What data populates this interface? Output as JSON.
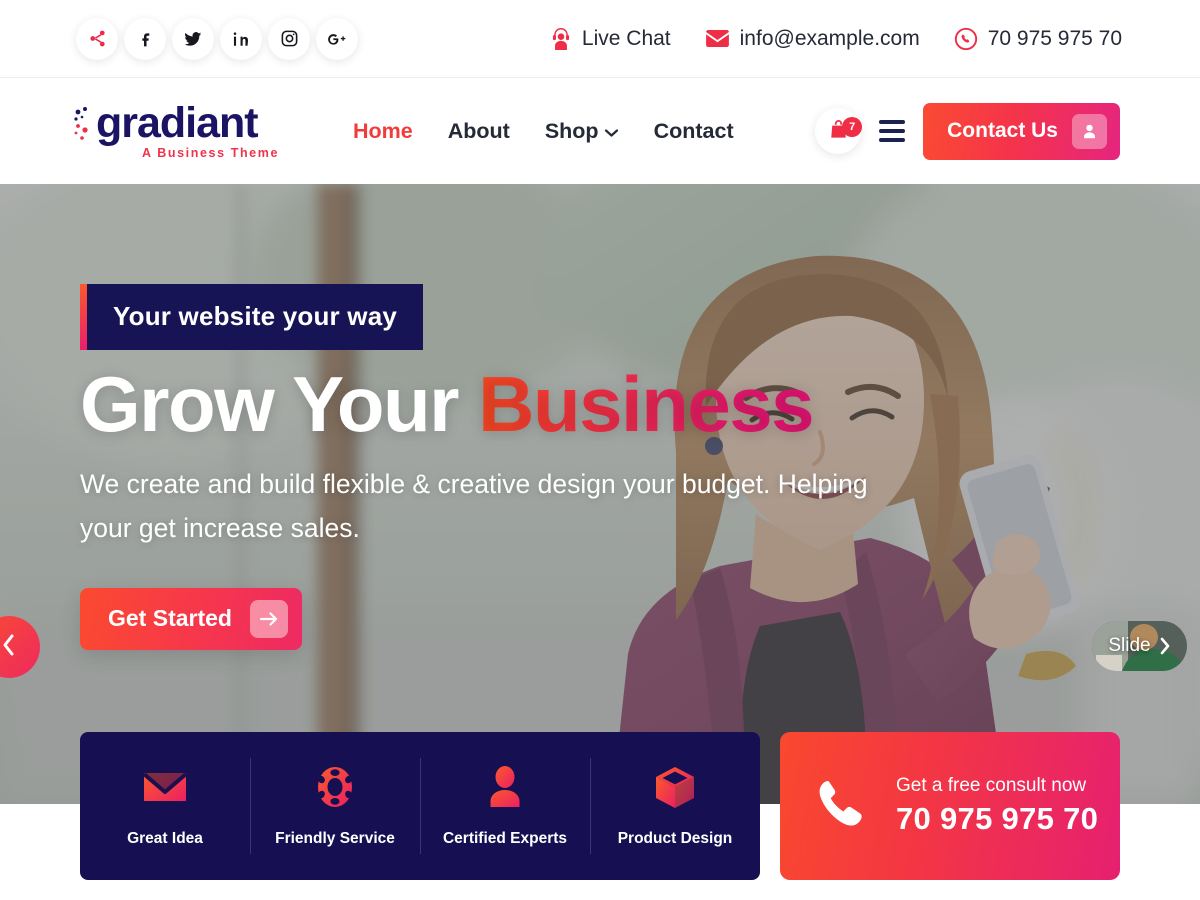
{
  "topbar": {
    "social": [
      {
        "name": "share-icon",
        "label": "Share"
      },
      {
        "name": "facebook-icon",
        "label": "Facebook"
      },
      {
        "name": "twitter-icon",
        "label": "Twitter"
      },
      {
        "name": "linkedin-icon",
        "label": "LinkedIn"
      },
      {
        "name": "instagram-icon",
        "label": "Instagram"
      },
      {
        "name": "googleplus-icon",
        "label": "Google Plus"
      }
    ],
    "live_chat": "Live Chat",
    "email": "info@example.com",
    "phone": "70 975 975 70"
  },
  "header": {
    "logo_name": "gradiant",
    "logo_tagline": "A Business Theme",
    "nav": [
      {
        "label": "Home",
        "active": true,
        "has_chevron": false
      },
      {
        "label": "About",
        "active": false,
        "has_chevron": false
      },
      {
        "label": "Shop",
        "active": false,
        "has_chevron": true
      },
      {
        "label": "Contact",
        "active": false,
        "has_chevron": false
      }
    ],
    "cart_count": "7",
    "contact_button": "Contact Us"
  },
  "hero": {
    "badge": "Your website your way",
    "title_white": "Grow Your",
    "title_accent": "Business",
    "subtitle": "We create and build flexible & creative design your budget. Helping your get increase sales.",
    "cta": "Get Started",
    "slide_next_label": "Slide"
  },
  "features": [
    {
      "label": "Great Idea",
      "icon": "envelope-icon"
    },
    {
      "label": "Friendly Service",
      "icon": "lifebuoy-icon"
    },
    {
      "label": "Certified Experts",
      "icon": "user-icon"
    },
    {
      "label": "Product Design",
      "icon": "box-icon"
    }
  ],
  "consult": {
    "title": "Get a free consult now",
    "phone": "70 975 975 70"
  },
  "colors": {
    "accent_red": "#f43b3b",
    "accent_orange": "#fa4b32",
    "accent_pink": "#e5257f",
    "navy": "#161052",
    "dark_text": "#242a36"
  }
}
